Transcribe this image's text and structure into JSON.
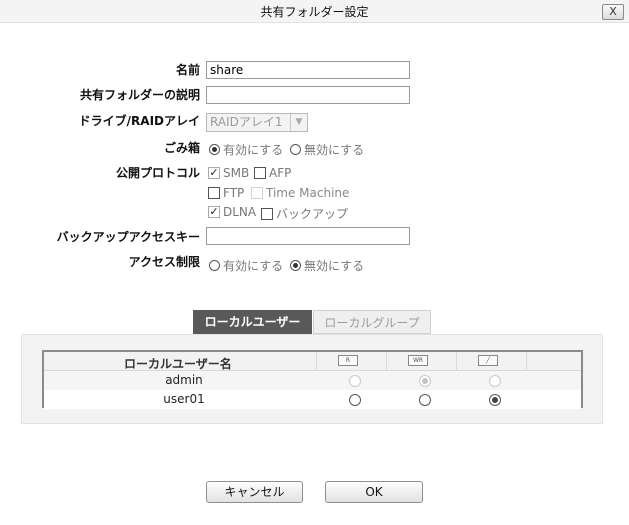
{
  "window": {
    "title": "共有フォルダー設定",
    "close_label": "X"
  },
  "form": {
    "name_label": "名前",
    "name_value": "share",
    "desc_label": "共有フォルダーの説明",
    "desc_value": "",
    "drive_label": "ドライブ/RAIDアレイ",
    "drive_value": "RAIDアレイ1",
    "trash_label": "ごみ箱",
    "trash_enable": "有効にする",
    "trash_disable": "無効にする",
    "protocol_label": "公開プロトコル",
    "protocols": {
      "smb": "SMB",
      "afp": "AFP",
      "ftp": "FTP",
      "time_machine": "Time Machine",
      "dlna": "DLNA",
      "backup": "バックアップ"
    },
    "backup_key_label": "バックアップアクセスキー",
    "backup_key_value": "",
    "access_label": "アクセス制限",
    "access_enable": "有効にする",
    "access_disable": "無効にする"
  },
  "tabs": {
    "local_users": "ローカルユーザー",
    "local_groups": "ローカルグループ"
  },
  "table": {
    "header_name": "ローカルユーザー名",
    "header_icons": [
      "read-only-icon",
      "write-read-icon",
      "no-access-icon"
    ],
    "rows": [
      {
        "name": "admin",
        "selected": "read-write",
        "disabled": true
      },
      {
        "name": "user01",
        "selected": "no-access",
        "disabled": false
      }
    ]
  },
  "buttons": {
    "cancel": "キャンセル",
    "ok": "OK"
  }
}
